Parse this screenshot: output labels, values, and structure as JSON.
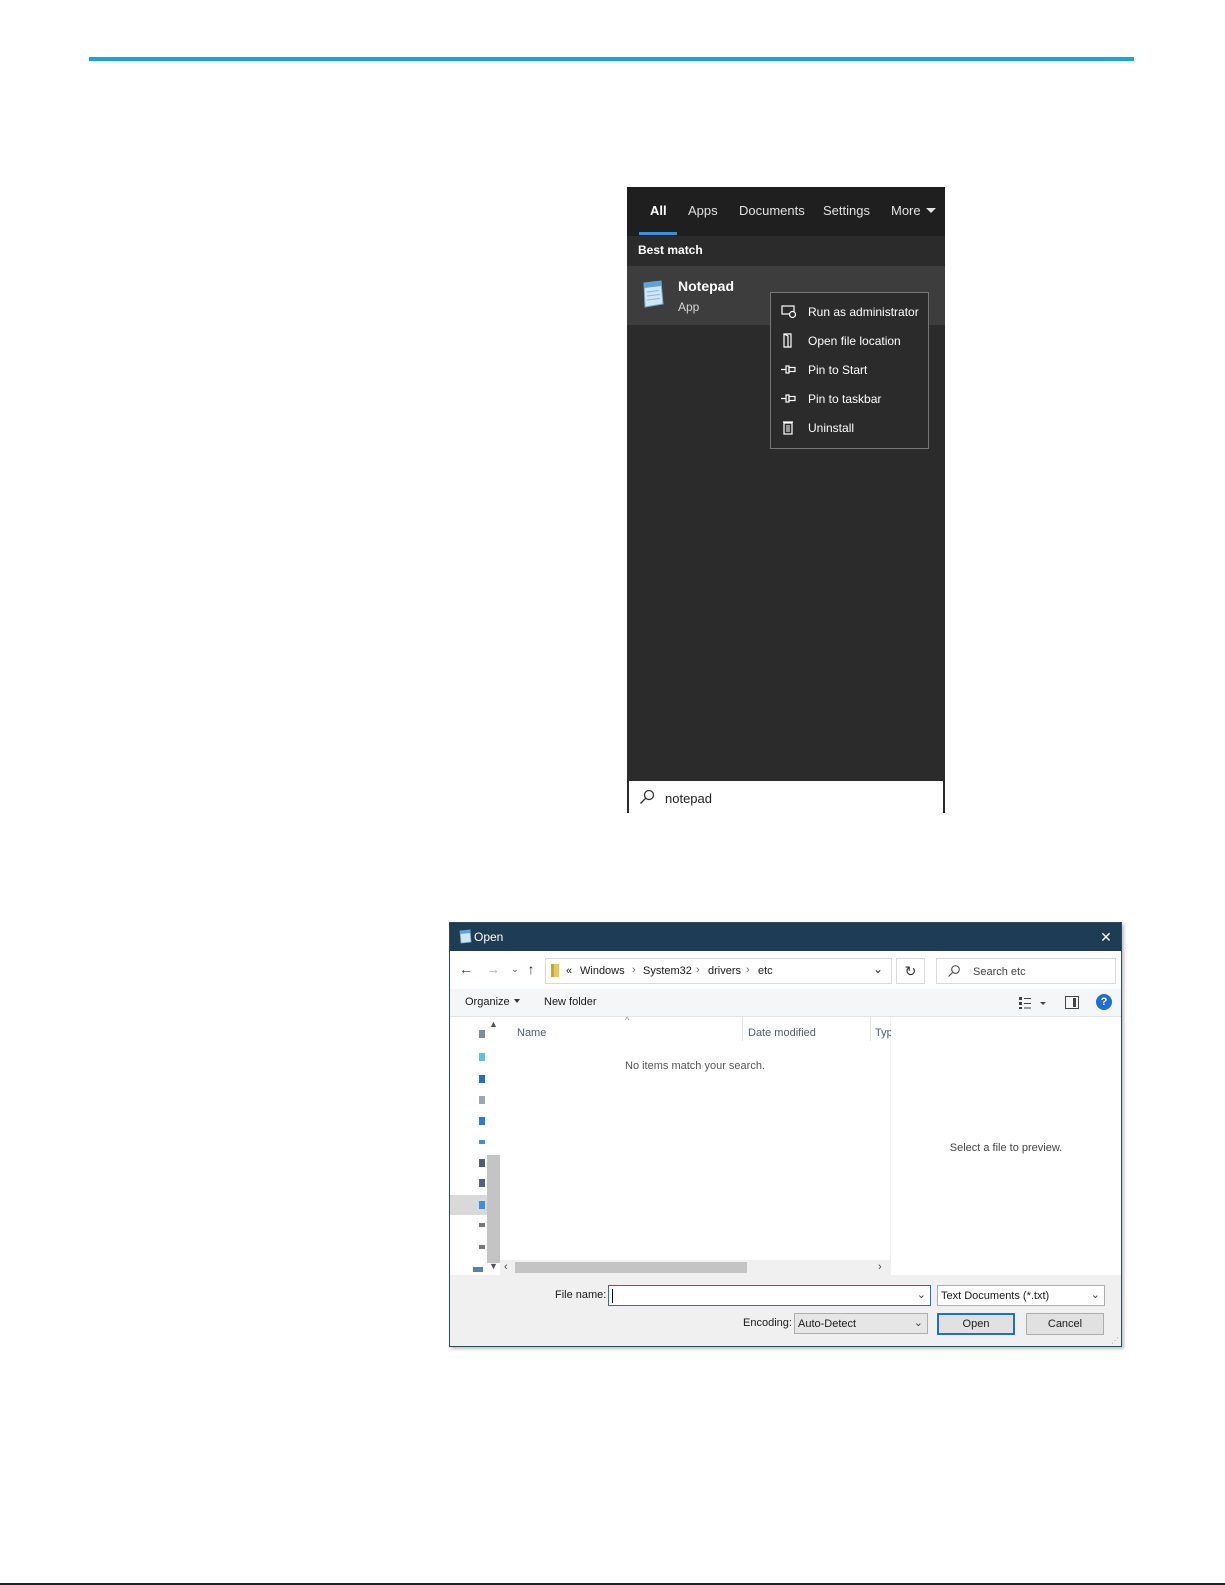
{
  "colors": {
    "accent_rule": "#1aa3dd",
    "start_bg": "#2b2b2b",
    "tab_underline": "#3a8fe0",
    "dialog_titlebar": "#1f3c55",
    "focus_blue": "#1e6fcf"
  },
  "start_search": {
    "tabs": [
      {
        "label": "All",
        "active": true
      },
      {
        "label": "Apps"
      },
      {
        "label": "Documents"
      },
      {
        "label": "Settings"
      },
      {
        "label": "More"
      }
    ],
    "section_label": "Best match",
    "best_match": {
      "name": "Notepad",
      "kind": "App",
      "icon": "notepad-icon"
    },
    "context_menu": [
      {
        "label": "Run as administrator",
        "icon": "shield-window-icon"
      },
      {
        "label": "Open file location",
        "icon": "folder-open-icon"
      },
      {
        "label": "Pin to Start",
        "icon": "pin-icon"
      },
      {
        "label": "Pin to taskbar",
        "icon": "pin-icon"
      },
      {
        "label": "Uninstall",
        "icon": "trash-icon"
      }
    ],
    "search_query": "notepad"
  },
  "open_dialog": {
    "title": "Open",
    "breadcrumb": [
      "«",
      "Windows",
      "System32",
      "drivers",
      "etc"
    ],
    "search_placeholder": "Search etc",
    "toolbar": {
      "organize": "Organize",
      "new_folder": "New folder"
    },
    "columns": [
      "Name",
      "Date modified",
      "Typ"
    ],
    "empty_message": "No items match your search.",
    "preview_message": "Select a file to preview.",
    "file_name_label": "File name:",
    "file_name_value": "",
    "file_type": "Text Documents (*.txt)",
    "encoding_label": "Encoding:",
    "encoding_value": "Auto-Detect",
    "open_button": "Open",
    "cancel_button": "Cancel"
  }
}
